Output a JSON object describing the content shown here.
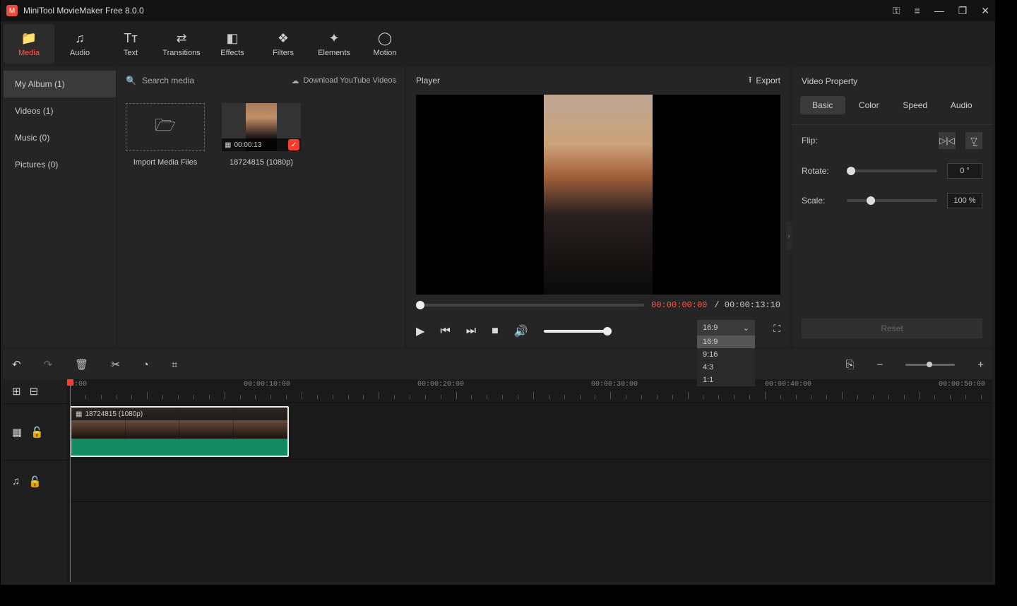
{
  "titlebar": {
    "title": "MiniTool MovieMaker Free 8.0.0"
  },
  "top_tabs": [
    {
      "icon": "📁",
      "label": "Media",
      "active": true
    },
    {
      "icon": "♫",
      "label": "Audio"
    },
    {
      "icon": "Tᴛ",
      "label": "Text"
    },
    {
      "icon": "⇄",
      "label": "Transitions"
    },
    {
      "icon": "◧",
      "label": "Effects"
    },
    {
      "icon": "❖",
      "label": "Filters"
    },
    {
      "icon": "✦",
      "label": "Elements"
    },
    {
      "icon": "◯",
      "label": "Motion"
    }
  ],
  "albums": [
    {
      "label": "My Album (1)",
      "active": true
    },
    {
      "label": "Videos (1)"
    },
    {
      "label": "Music (0)"
    },
    {
      "label": "Pictures (0)"
    }
  ],
  "media_panel": {
    "search_placeholder": "Search media",
    "download_label": "Download YouTube Videos",
    "import_label": "Import Media Files",
    "clip": {
      "duration": "00:00:13",
      "name": "18724815 (1080p)"
    }
  },
  "player": {
    "title": "Player",
    "export": "Export",
    "time_current": "00:00:00:00",
    "time_sep": " / ",
    "time_total": "00:00:13:10",
    "ratio_selected": "16:9",
    "ratio_options": [
      "16:9",
      "9:16",
      "4:3",
      "1:1"
    ]
  },
  "props": {
    "title": "Video Property",
    "tabs": [
      "Basic",
      "Color",
      "Speed",
      "Audio"
    ],
    "flip_label": "Flip:",
    "rotate_label": "Rotate:",
    "rotate_value": "0 °",
    "scale_label": "Scale:",
    "scale_value": "100 %",
    "reset": "Reset"
  },
  "timeline": {
    "ruler": [
      "0:00",
      "00:00:10:00",
      "00:00:20:00",
      "00:00:30:00",
      "00:00:40:00",
      "00:00:50:00"
    ],
    "clip_name": "18724815 (1080p)"
  }
}
